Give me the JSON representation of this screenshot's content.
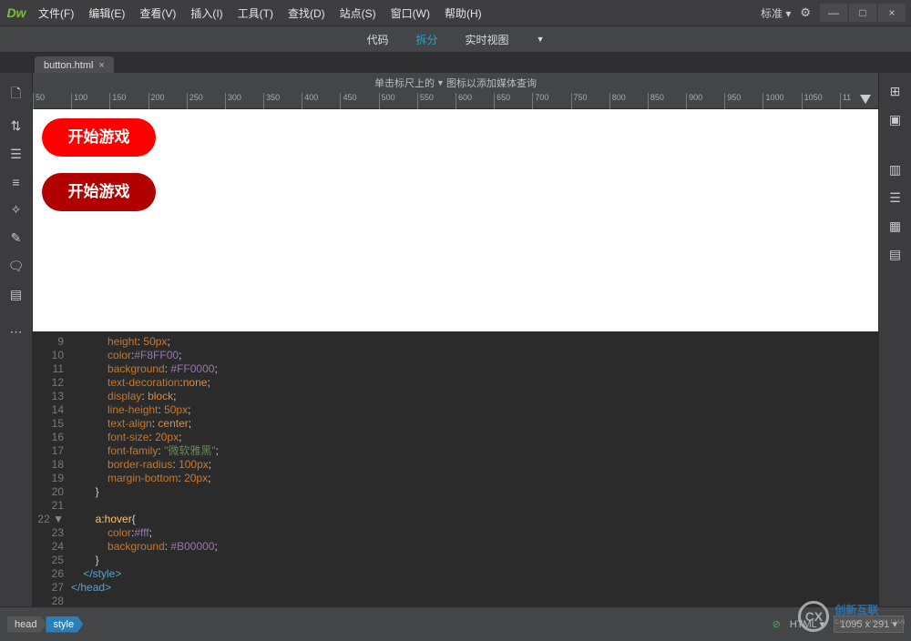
{
  "app": {
    "logo": "Dw"
  },
  "menu": {
    "file": "文件(F)",
    "edit": "编辑(E)",
    "view": "查看(V)",
    "insert": "插入(I)",
    "tools": "工具(T)",
    "find": "查找(D)",
    "site": "站点(S)",
    "window": "窗口(W)",
    "help": "帮助(H)"
  },
  "titleRight": {
    "standard": "标准 ▾",
    "gear": "✿"
  },
  "viewbar": {
    "code": "代码",
    "split": "拆分",
    "live": "实时视图"
  },
  "tab": {
    "filename": "button.html",
    "close": "×"
  },
  "rulerHint": {
    "pre": "单击标尺上的",
    "post": "图标以添加媒体查询"
  },
  "rulerTicks": [
    "50",
    "100",
    "150",
    "200",
    "250",
    "300",
    "350",
    "400",
    "450",
    "500",
    "550",
    "600",
    "650",
    "700",
    "750",
    "800",
    "850",
    "900",
    "950",
    "1000",
    "1050",
    "11"
  ],
  "preview": {
    "btn1": "开始游戏",
    "btn2": "开始游戏"
  },
  "code": {
    "lines": [
      {
        "n": "9",
        "fold": "",
        "html": "            <span class='c-prop'>height</span><span class='c-punc'>:</span> <span class='c-num'>50px</span><span class='c-punc'>;</span>"
      },
      {
        "n": "10",
        "fold": "",
        "html": "            <span class='c-prop'>color</span><span class='c-punc'>:</span><span class='c-hex'>#F8FF00</span><span class='c-punc'>;</span>"
      },
      {
        "n": "11",
        "fold": "",
        "html": "            <span class='c-prop'>background</span><span class='c-punc'>:</span> <span class='c-hex'>#FF0000</span><span class='c-punc'>;</span>"
      },
      {
        "n": "12",
        "fold": "",
        "html": "            <span class='c-prop'>text-decoration</span><span class='c-punc'>:</span><span class='c-val'>none</span><span class='c-punc'>;</span>"
      },
      {
        "n": "13",
        "fold": "",
        "html": "            <span class='c-prop'>display</span><span class='c-punc'>:</span> <span class='c-val'>block</span><span class='c-punc'>;</span>"
      },
      {
        "n": "14",
        "fold": "",
        "html": "            <span class='c-prop'>line-height</span><span class='c-punc'>:</span> <span class='c-num'>50px</span><span class='c-punc'>;</span>"
      },
      {
        "n": "15",
        "fold": "",
        "html": "            <span class='c-prop'>text-align</span><span class='c-punc'>:</span> <span class='c-val'>center</span><span class='c-punc'>;</span>"
      },
      {
        "n": "16",
        "fold": "",
        "html": "            <span class='c-prop'>font-size</span><span class='c-punc'>:</span> <span class='c-num'>20px</span><span class='c-punc'>;</span>"
      },
      {
        "n": "17",
        "fold": "",
        "html": "            <span class='c-prop'>font-family</span><span class='c-punc'>:</span> <span class='c-str'>\"微软雅黑\"</span><span class='c-punc'>;</span>"
      },
      {
        "n": "18",
        "fold": "",
        "html": "            <span class='c-prop'>border-radius</span><span class='c-punc'>:</span> <span class='c-num'>100px</span><span class='c-punc'>;</span>"
      },
      {
        "n": "19",
        "fold": "",
        "html": "            <span class='c-prop'>margin-bottom</span><span class='c-punc'>:</span> <span class='c-num'>20px</span><span class='c-punc'>;</span>"
      },
      {
        "n": "20",
        "fold": "",
        "html": "        <span class='c-brace'>}</span>"
      },
      {
        "n": "21",
        "fold": "",
        "html": ""
      },
      {
        "n": "22",
        "fold": "▼",
        "html": "        <span class='c-sel'>a:hover</span><span class='c-brace'>{</span>"
      },
      {
        "n": "23",
        "fold": "",
        "html": "            <span class='c-prop'>color</span><span class='c-punc'>:</span><span class='c-hex'>#fff</span><span class='c-punc'>;</span>"
      },
      {
        "n": "24",
        "fold": "",
        "html": "            <span class='c-prop'>background</span><span class='c-punc'>:</span> <span class='c-hex'>#B00000</span><span class='c-punc'>;</span>"
      },
      {
        "n": "25",
        "fold": "",
        "html": "        <span class='c-brace'>}</span>"
      },
      {
        "n": "26",
        "fold": "",
        "html": "    <span class='c-tag'>&lt;/style&gt;</span>"
      },
      {
        "n": "27",
        "fold": "",
        "html": "<span class='c-tag'>&lt;/head&gt;</span>"
      },
      {
        "n": "28",
        "fold": "",
        "html": ""
      }
    ]
  },
  "status": {
    "crumb1": "head",
    "crumb2": "style",
    "lang": "HTML",
    "dims": "1095 x 291"
  },
  "watermark": {
    "zh": "创新互联",
    "py": "CHUANG XIN HU LIAN"
  }
}
